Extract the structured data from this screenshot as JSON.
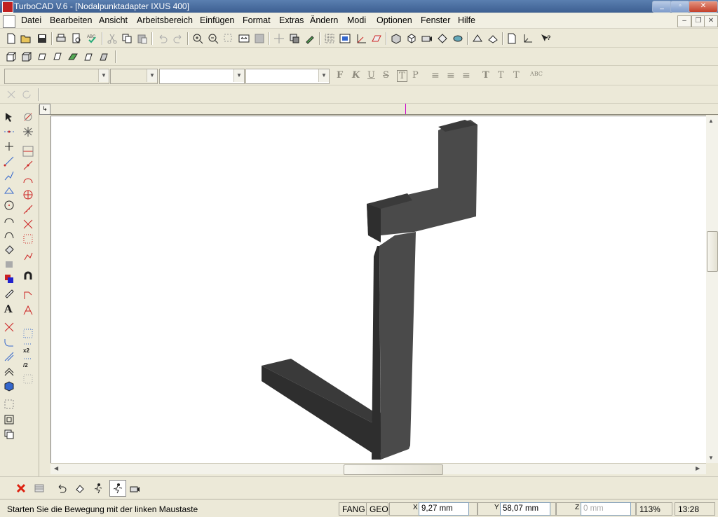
{
  "app": {
    "title": "TurboCAD V.6 - [Nodalpunktadapter IXUS 400]",
    "icon": "turbocad-app-icon"
  },
  "window_controls": {
    "minimize": "minimize-icon",
    "maximize": "maximize-icon",
    "close": "close-icon"
  },
  "menubar": {
    "items": [
      "Datei",
      "Bearbeiten",
      "Ansicht",
      "Arbeitsbereich",
      "Einfügen",
      "Format",
      "Extras",
      "Ändern",
      "Modi",
      "Optionen",
      "Fenster",
      "Hilfe"
    ]
  },
  "toolbar_standard": [
    "new-icon",
    "open-icon",
    "save-icon",
    "print-icon",
    "print-preview-icon",
    "spellcheck-icon",
    "cut-icon",
    "copy-icon",
    "paste-icon",
    "undo-icon",
    "redo-icon",
    "zoom-in-icon",
    "zoom-out-icon",
    "zoom-window-icon",
    "zoom-all-icon",
    "redraw-icon",
    "pan-icon",
    "layer-icon",
    "pick-icon",
    "snap-grid-icon",
    "render-icon",
    "dimension-icon",
    "workplane-icon",
    "view-3d-icon",
    "iso-view-icon",
    "camera-icon",
    "walk-icon",
    "orbit-icon",
    "light-icon",
    "texture-icon",
    "page-icon",
    "axis-icon",
    "help-icon"
  ],
  "toolbar_3d": [
    "box-3d-icon",
    "box-face-icon",
    "extrude-icon",
    "revolve-icon",
    "sweep-icon",
    "loft-icon"
  ],
  "format_toolbar": {
    "font_name": "",
    "font_size": "",
    "style_combo": "",
    "pen_combo": "",
    "buttons": [
      "F",
      "K",
      "U",
      "S",
      "T",
      "P",
      "align-left",
      "align-center",
      "align-right",
      "T",
      "T",
      "T",
      "ABC"
    ]
  },
  "toolbox": {
    "left": [
      "select-icon",
      "point-icon",
      "crosshair-icon",
      "line-icon",
      "polyline-icon",
      "rectangle-icon",
      "circle-icon",
      "arc-icon",
      "curve-icon",
      "fill-icon",
      "eraser-icon",
      "color-icon",
      "transform-icon",
      "text-icon",
      "intersect-icon",
      "fillet-icon",
      "trim-icon",
      "offset-icon",
      "solid-icon",
      "block-icon",
      "group-icon",
      "copy-object-icon"
    ],
    "right": [
      "snap-free-icon",
      "snap-vertex-icon",
      "snap-line-icon",
      "snap-mid-icon",
      "snap-center-icon",
      "snap-quadrant-icon",
      "snap-tangent-icon",
      "snap-intersect-icon",
      "snap-grid-icon",
      "snap-draw-icon",
      "snap-magnet-icon",
      "snap-direction-icon",
      "snap-angle-icon",
      "snap-divide-icon",
      "snap-x2-icon",
      "snap-half-icon",
      "snap-relative-icon"
    ]
  },
  "canvas": {
    "model_color": "#4a4a4a",
    "model_top": "#3a3a3a",
    "model_side": "#2e2e2e",
    "ruler_marker_color": "#cc00cc"
  },
  "bottom_toolbar": [
    "cancel-icon",
    "properties-icon",
    "undo-move-icon",
    "walk-icon",
    "run-icon",
    "fly-icon",
    "camera-orbit-icon"
  ],
  "status": {
    "message": "Starten Sie die Bewegung mit der linken Maustaste",
    "fang": "FANG",
    "geo": "GEO",
    "x_label": "X",
    "x_value": "9,27 mm",
    "y_label": "Y",
    "y_value": "58,07 mm",
    "z_label": "Z",
    "z_value": "0 mm",
    "zoom": "113%",
    "time": "13:28"
  }
}
